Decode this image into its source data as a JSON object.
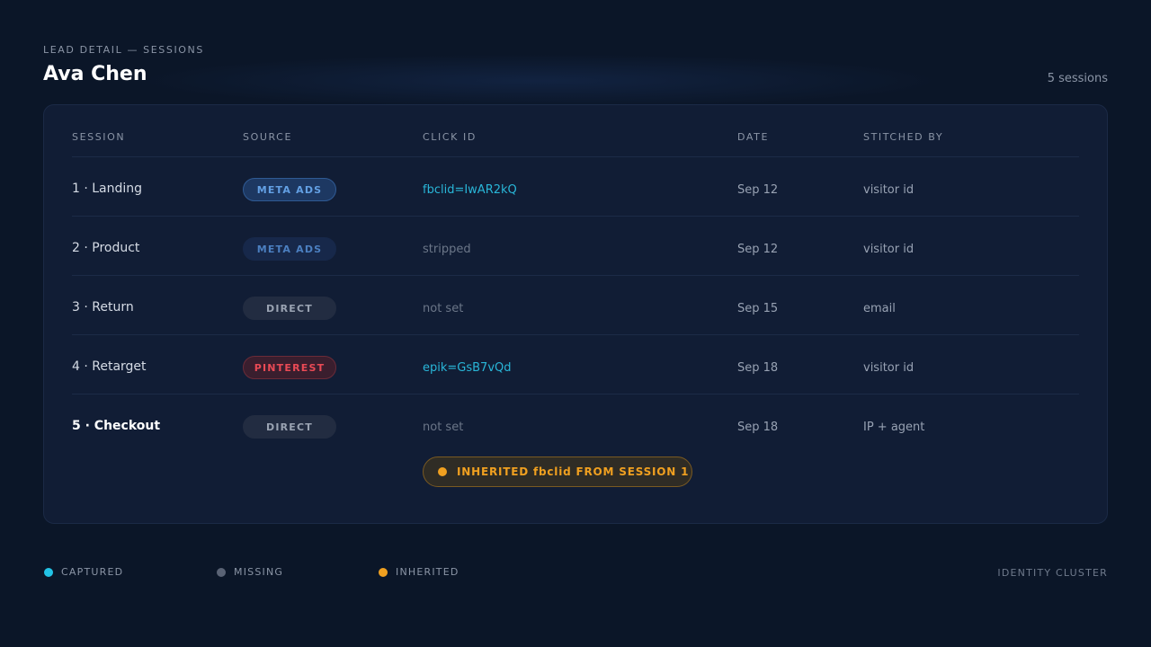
{
  "header": {
    "eyebrow": "LEAD DETAIL — SESSIONS",
    "title": "Ava Chen",
    "session_count": "5 sessions"
  },
  "table": {
    "columns": [
      "SESSION",
      "SOURCE",
      "CLICK ID",
      "DATE",
      "STITCHED BY"
    ],
    "rows": [
      {
        "session": "1 · Landing",
        "source": "META ADS",
        "click_id": "fbclid=IwAR2kQ",
        "date": "Sep 12",
        "stitched_by": "visitor id"
      },
      {
        "session": "2 · Product",
        "source": "META ADS",
        "click_id": "stripped",
        "date": "Sep 12",
        "stitched_by": "visitor id"
      },
      {
        "session": "3 · Return",
        "source": "DIRECT",
        "click_id": "not set",
        "date": "Sep 15",
        "stitched_by": "email"
      },
      {
        "session": "4 · Retarget",
        "source": "PINTEREST",
        "click_id": "epik=GsB7vQd",
        "date": "Sep 18",
        "stitched_by": "visitor id"
      },
      {
        "session": "5 · Checkout",
        "source": "DIRECT",
        "click_id": "not set",
        "date": "Sep 18",
        "stitched_by": "IP + agent"
      }
    ],
    "inherited_note": "INHERITED fbclid FROM SESSION 1"
  },
  "legend": {
    "items": [
      {
        "label": "CAPTURED",
        "color": "#22c3e6"
      },
      {
        "label": "MISSING",
        "color": "#5a6375"
      },
      {
        "label": "INHERITED",
        "color": "#f0a020"
      }
    ],
    "cluster_label": "IDENTITY CLUSTER"
  },
  "colors": {
    "background": "#0b1628",
    "panel": "#111d35",
    "captured": "#29b6d8",
    "meta": "#63a0e4",
    "pinterest": "#ea4a55",
    "inherited": "#f0a020"
  }
}
